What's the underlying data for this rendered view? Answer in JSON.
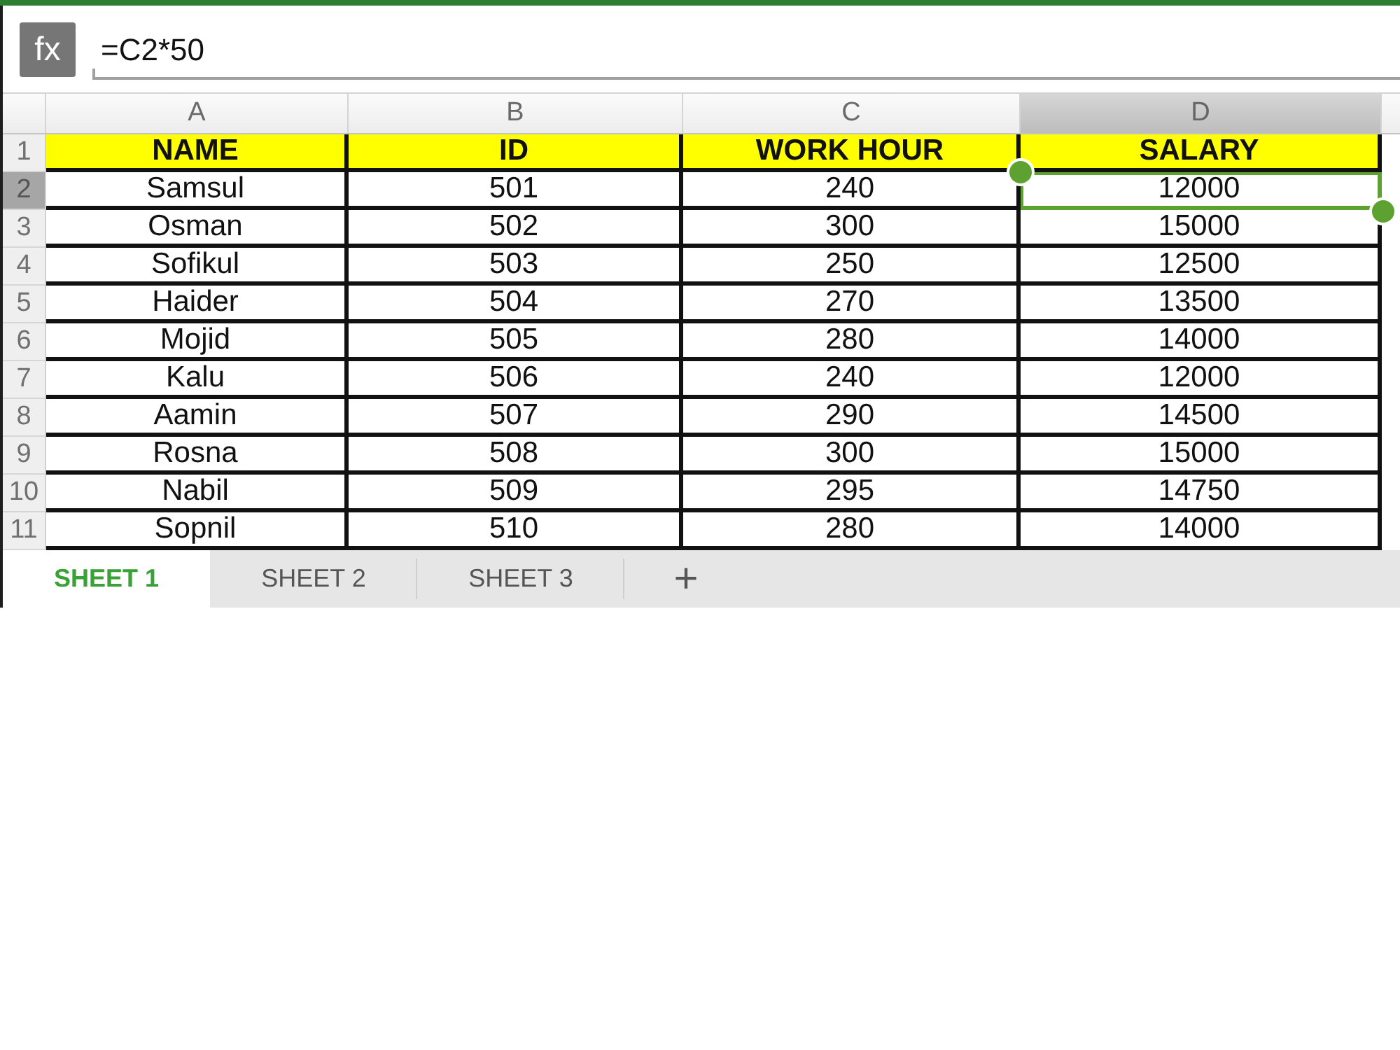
{
  "formula_bar": {
    "button": "fx",
    "formula": "=C2*50"
  },
  "sheet": {
    "columns": [
      {
        "label": "A",
        "selected": false
      },
      {
        "label": "B",
        "selected": false
      },
      {
        "label": "C",
        "selected": false
      },
      {
        "label": "D",
        "selected": true
      }
    ],
    "rows": [
      {
        "number": "1",
        "selected": false,
        "kind": "header",
        "cells": [
          {
            "text": "NAME",
            "selected": false
          },
          {
            "text": "ID",
            "selected": false
          },
          {
            "text": "WORK HOUR",
            "selected": false
          },
          {
            "text": "SALARY",
            "selected": false
          }
        ]
      },
      {
        "number": "2",
        "selected": true,
        "kind": "data",
        "cells": [
          {
            "text": "Samsul",
            "selected": false
          },
          {
            "text": "501",
            "selected": false
          },
          {
            "text": "240",
            "selected": false
          },
          {
            "text": "12000",
            "selected": true
          }
        ]
      },
      {
        "number": "3",
        "selected": false,
        "kind": "data",
        "cells": [
          {
            "text": "Osman",
            "selected": false
          },
          {
            "text": "502",
            "selected": false
          },
          {
            "text": "300",
            "selected": false
          },
          {
            "text": "15000",
            "selected": false
          }
        ]
      },
      {
        "number": "4",
        "selected": false,
        "kind": "data",
        "cells": [
          {
            "text": "Sofikul",
            "selected": false
          },
          {
            "text": "503",
            "selected": false
          },
          {
            "text": "250",
            "selected": false
          },
          {
            "text": "12500",
            "selected": false
          }
        ]
      },
      {
        "number": "5",
        "selected": false,
        "kind": "data",
        "cells": [
          {
            "text": "Haider",
            "selected": false
          },
          {
            "text": "504",
            "selected": false
          },
          {
            "text": "270",
            "selected": false
          },
          {
            "text": "13500",
            "selected": false
          }
        ]
      },
      {
        "number": "6",
        "selected": false,
        "kind": "data",
        "cells": [
          {
            "text": "Mojid",
            "selected": false
          },
          {
            "text": "505",
            "selected": false
          },
          {
            "text": "280",
            "selected": false
          },
          {
            "text": "14000",
            "selected": false
          }
        ]
      },
      {
        "number": "7",
        "selected": false,
        "kind": "data",
        "cells": [
          {
            "text": "Kalu",
            "selected": false
          },
          {
            "text": "506",
            "selected": false
          },
          {
            "text": "240",
            "selected": false
          },
          {
            "text": "12000",
            "selected": false
          }
        ]
      },
      {
        "number": "8",
        "selected": false,
        "kind": "data",
        "cells": [
          {
            "text": "Aamin",
            "selected": false
          },
          {
            "text": "507",
            "selected": false
          },
          {
            "text": "290",
            "selected": false
          },
          {
            "text": "14500",
            "selected": false
          }
        ]
      },
      {
        "number": "9",
        "selected": false,
        "kind": "data",
        "cells": [
          {
            "text": "Rosna",
            "selected": false
          },
          {
            "text": "508",
            "selected": false
          },
          {
            "text": "300",
            "selected": false
          },
          {
            "text": "15000",
            "selected": false
          }
        ]
      },
      {
        "number": "10",
        "selected": false,
        "kind": "data",
        "cells": [
          {
            "text": "Nabil",
            "selected": false
          },
          {
            "text": "509",
            "selected": false
          },
          {
            "text": "295",
            "selected": false
          },
          {
            "text": "14750",
            "selected": false
          }
        ]
      },
      {
        "number": "11",
        "selected": false,
        "kind": "data",
        "cells": [
          {
            "text": "Sopnil",
            "selected": false
          },
          {
            "text": "510",
            "selected": false
          },
          {
            "text": "280",
            "selected": false
          },
          {
            "text": "14000",
            "selected": false
          }
        ]
      }
    ]
  },
  "sheet_tabs": [
    {
      "label": "SHEET 1",
      "selected": true
    },
    {
      "label": "SHEET 2",
      "selected": false
    },
    {
      "label": "SHEET 3",
      "selected": false
    }
  ],
  "add_sheet_button": "+"
}
